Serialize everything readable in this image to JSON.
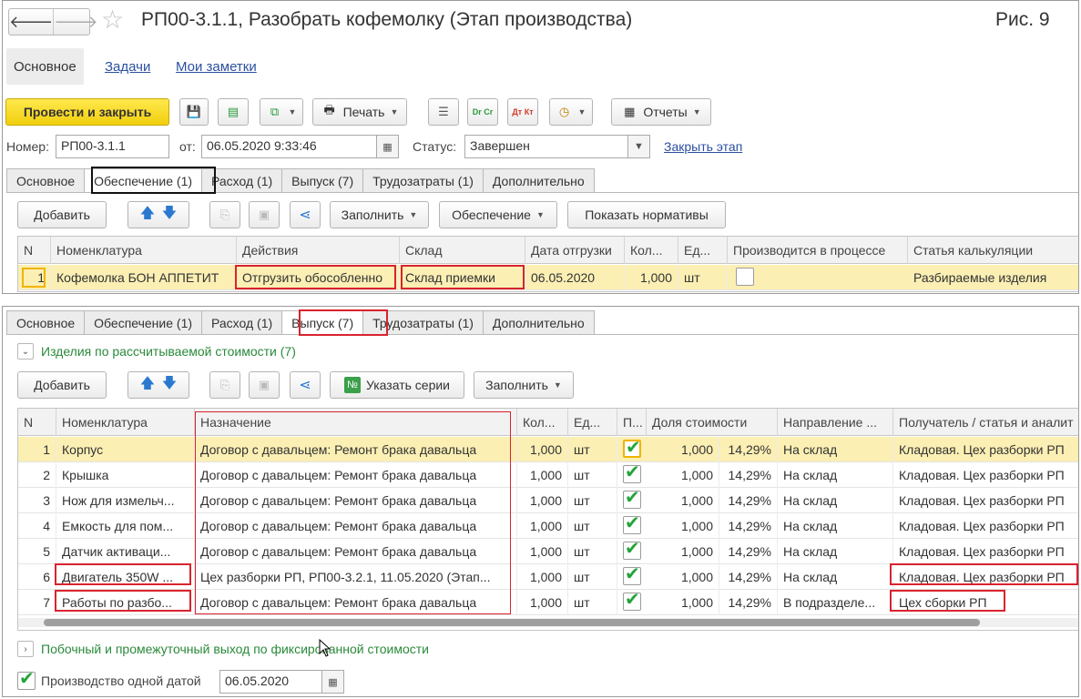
{
  "header": {
    "back_glyph": "🡐",
    "forward_glyph": "🡒",
    "title": "РП00-3.1.1, Разобрать кофемолку (Этап производства)",
    "figure": "Рис. 9"
  },
  "main_tabs": [
    "Основное",
    "Задачи",
    "Мои заметки"
  ],
  "toolbar": {
    "post_close": "Провести и закрыть",
    "print": "Печать",
    "reports": "Отчеты",
    "dt_cr_label": "Dr Cr",
    "dt_kt_label": "Дт Кт"
  },
  "form": {
    "number_label": "Номер:",
    "number_value": "РП00-3.1.1",
    "from_label": "от:",
    "date_value": "06.05.2020  9:33:46",
    "status_label": "Статус:",
    "status_value": "Завершен",
    "close_stage": "Закрыть этап"
  },
  "top_tabs": [
    "Основное",
    "Обеспечение (1)",
    "Расход (1)",
    "Выпуск (7)",
    "Трудозатраты (1)",
    "Дополнительно"
  ],
  "top_toolbar": {
    "add": "Добавить",
    "fill": "Заполнить",
    "provision": "Обеспечение",
    "show_norms": "Показать нормативы"
  },
  "top_grid": {
    "columns": [
      "N",
      "Номенклатура",
      "Действия",
      "Склад",
      "Дата отгрузки",
      "Кол...",
      "Ед...",
      "Производится в процессе",
      "Статья калькуляции"
    ],
    "rows": [
      {
        "n": "1",
        "item": "Кофемолка БОН АППЕТИТ",
        "action": "Отгрузить обособленно",
        "warehouse": "Склад приемки",
        "date": "06.05.2020",
        "qty": "1,000",
        "unit": "шт",
        "in_process": false,
        "cost_item": "Разбираемые изделия"
      }
    ]
  },
  "bottom_tabs": [
    "Основное",
    "Обеспечение (1)",
    "Расход (1)",
    "Выпуск (7)",
    "Трудозатраты (1)",
    "Дополнительно"
  ],
  "bottom_section": {
    "group_title": "Изделия по рассчитываемой стоимости (7)",
    "add": "Добавить",
    "series_icon": "№",
    "specify_series": "Указать серии",
    "fill": "Заполнить",
    "side_output": "Побочный и промежуточный выход по фиксированной стоимости",
    "one_date_label": "Производство одной датой",
    "one_date_value": "06.05.2020"
  },
  "bottom_grid": {
    "columns": [
      "N",
      "Номенклатура",
      "Назначение",
      "Кол...",
      "Ед...",
      "П...",
      "Доля стоимости",
      "Направление ...",
      "Получатель / статья и аналит"
    ],
    "rows": [
      {
        "n": "1",
        "item": "Корпус",
        "purpose": "Договор с давальцем: Ремонт брака давальца",
        "qty": "1,000",
        "unit": "шт",
        "checked": true,
        "share_qty": "1,000",
        "share_pct": "14,29%",
        "direction": "На склад",
        "recipient": "Кладовая. Цех разборки РП"
      },
      {
        "n": "2",
        "item": "Крышка",
        "purpose": "Договор с давальцем: Ремонт брака давальца",
        "qty": "1,000",
        "unit": "шт",
        "checked": true,
        "share_qty": "1,000",
        "share_pct": "14,29%",
        "direction": "На склад",
        "recipient": "Кладовая. Цех разборки РП"
      },
      {
        "n": "3",
        "item": "Нож для измельч...",
        "purpose": "Договор с давальцем: Ремонт брака давальца",
        "qty": "1,000",
        "unit": "шт",
        "checked": true,
        "share_qty": "1,000",
        "share_pct": "14,29%",
        "direction": "На склад",
        "recipient": "Кладовая. Цех разборки РП"
      },
      {
        "n": "4",
        "item": "Емкость для пом...",
        "purpose": "Договор с давальцем: Ремонт брака давальца",
        "qty": "1,000",
        "unit": "шт",
        "checked": true,
        "share_qty": "1,000",
        "share_pct": "14,29%",
        "direction": "На склад",
        "recipient": "Кладовая. Цех разборки РП"
      },
      {
        "n": "5",
        "item": "Датчик активаци...",
        "purpose": "Договор с давальцем: Ремонт брака давальца",
        "qty": "1,000",
        "unit": "шт",
        "checked": true,
        "share_qty": "1,000",
        "share_pct": "14,29%",
        "direction": "На склад",
        "recipient": "Кладовая. Цех разборки РП"
      },
      {
        "n": "6",
        "item": "Двигатель 350W ...",
        "purpose": "Цех разборки РП, РП00-3.2.1, 11.05.2020 (Этап...",
        "qty": "1,000",
        "unit": "шт",
        "checked": true,
        "share_qty": "1,000",
        "share_pct": "14,29%",
        "direction": "На склад",
        "recipient": "Кладовая. Цех разборки РП"
      },
      {
        "n": "7",
        "item": "Работы по разбо...",
        "purpose": "Договор с давальцем: Ремонт брака давальца",
        "qty": "1,000",
        "unit": "шт",
        "checked": true,
        "share_qty": "1,000",
        "share_pct": "14,29%",
        "direction": "В подразделе...",
        "recipient": "Цех сборки РП"
      }
    ]
  }
}
